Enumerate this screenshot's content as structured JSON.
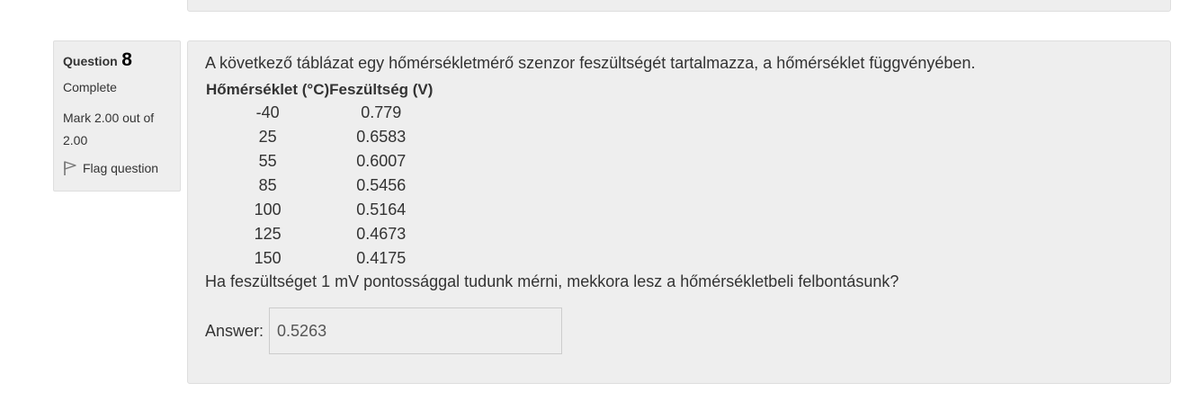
{
  "question": {
    "label": "Question",
    "number": "8",
    "state": "Complete",
    "grade": "Mark 2.00 out of 2.00",
    "flag_label": "Flag question",
    "text": "A következő táblázat egy hőmérsékletmérő szenzor feszültségét tartalmazza, a hőmérséklet függvényében.",
    "table": {
      "headers": [
        "Hőmérséklet (°C)",
        "Feszültség (V)"
      ],
      "rows": [
        [
          "-40",
          "0.779"
        ],
        [
          "25",
          "0.6583"
        ],
        [
          "55",
          "0.6007"
        ],
        [
          "85",
          "0.5456"
        ],
        [
          "100",
          "0.5164"
        ],
        [
          "125",
          "0.4673"
        ],
        [
          "150",
          "0.4175"
        ]
      ]
    },
    "prompt": "Ha feszültséget 1 mV pontossággal tudunk mérni, mekkora lesz a hőmérsékletbeli felbontásunk?",
    "answer_label": "Answer:",
    "answer_value": "0.5263"
  },
  "icons": {
    "flag": "flag-icon"
  }
}
